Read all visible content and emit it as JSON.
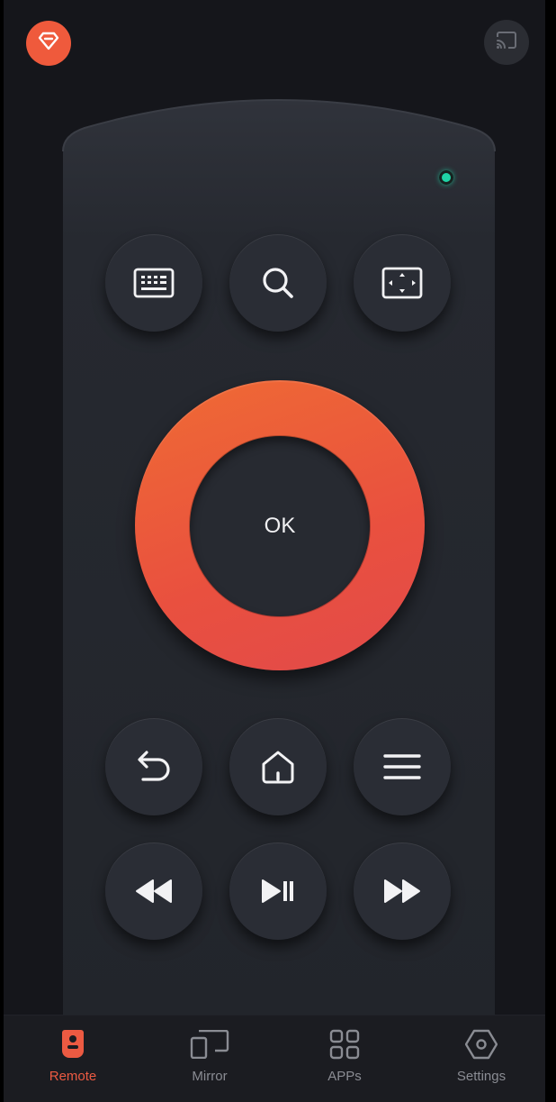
{
  "header": {
    "premium_icon": "diamond-icon",
    "cast_icon": "cast-icon"
  },
  "remote": {
    "status_led_color": "#1fd4a6",
    "top_buttons": [
      {
        "icon": "keyboard-icon"
      },
      {
        "icon": "search-icon"
      },
      {
        "icon": "aspect-ratio-icon"
      }
    ],
    "ok_label": "OK",
    "ok_ring_color": "#ec5a3c",
    "nav_buttons": [
      {
        "icon": "back-arrow-icon"
      },
      {
        "icon": "home-icon"
      },
      {
        "icon": "menu-icon"
      }
    ],
    "media_buttons": [
      {
        "icon": "rewind-icon"
      },
      {
        "icon": "play-pause-icon"
      },
      {
        "icon": "fast-forward-icon"
      }
    ]
  },
  "tabbar": {
    "accent_color": "#ec5a42",
    "tabs": [
      {
        "label": "Remote",
        "icon": "remote-icon",
        "active": true
      },
      {
        "label": "Mirror",
        "icon": "mirror-icon",
        "active": false
      },
      {
        "label": "APPs",
        "icon": "apps-grid-icon",
        "active": false
      },
      {
        "label": "Settings",
        "icon": "settings-hexagon-icon",
        "active": false
      }
    ]
  }
}
